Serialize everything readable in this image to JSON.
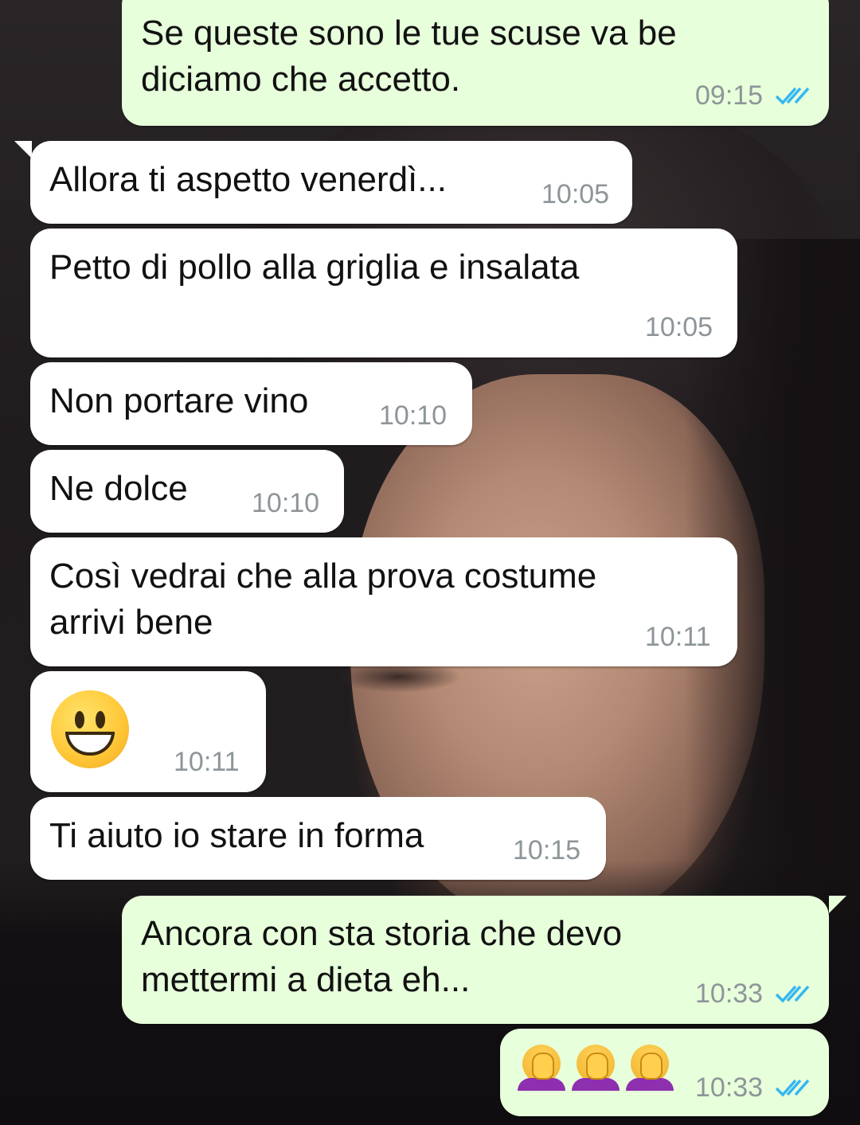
{
  "chat": {
    "messages": [
      {
        "id": "m1",
        "direction": "outgoing",
        "lines": [
          "Se queste sono le tue scuse va be",
          "diciamo che accetto."
        ],
        "time": "09:15",
        "status": "read"
      },
      {
        "id": "m2",
        "direction": "incoming",
        "lines": [
          "Allora ti aspetto venerdì..."
        ],
        "time": "10:05"
      },
      {
        "id": "m3",
        "direction": "incoming",
        "lines": [
          "Petto di pollo alla griglia e insalata"
        ],
        "time": "10:05"
      },
      {
        "id": "m4",
        "direction": "incoming",
        "lines": [
          "Non portare vino"
        ],
        "time": "10:10"
      },
      {
        "id": "m5",
        "direction": "incoming",
        "lines": [
          "Ne dolce"
        ],
        "time": "10:10"
      },
      {
        "id": "m6",
        "direction": "incoming",
        "lines": [
          "Così vedrai che alla prova costume",
          "arrivi bene"
        ],
        "time": "10:11"
      },
      {
        "id": "m7",
        "direction": "incoming",
        "emoji": "grinning-face",
        "time": "10:11"
      },
      {
        "id": "m8",
        "direction": "incoming",
        "lines": [
          "Ti aiuto io stare in forma"
        ],
        "time": "10:15"
      },
      {
        "id": "m9",
        "direction": "outgoing",
        "lines": [
          "Ancora con sta storia che devo",
          "mettermi a dieta eh..."
        ],
        "time": "10:33",
        "status": "read"
      },
      {
        "id": "m10",
        "direction": "outgoing",
        "emoji": "woman-facepalming",
        "emoji_count": 3,
        "time": "10:33",
        "status": "read"
      }
    ]
  },
  "colors": {
    "incoming_bubble": "#ffffff",
    "outgoing_bubble": "#e7ffdb",
    "timestamp": "#8e9599",
    "read_ticks": "#34b7f1"
  },
  "icons": {
    "read_receipt": "double-check-icon",
    "wallpaper": "portrait-photo-wallpaper"
  }
}
